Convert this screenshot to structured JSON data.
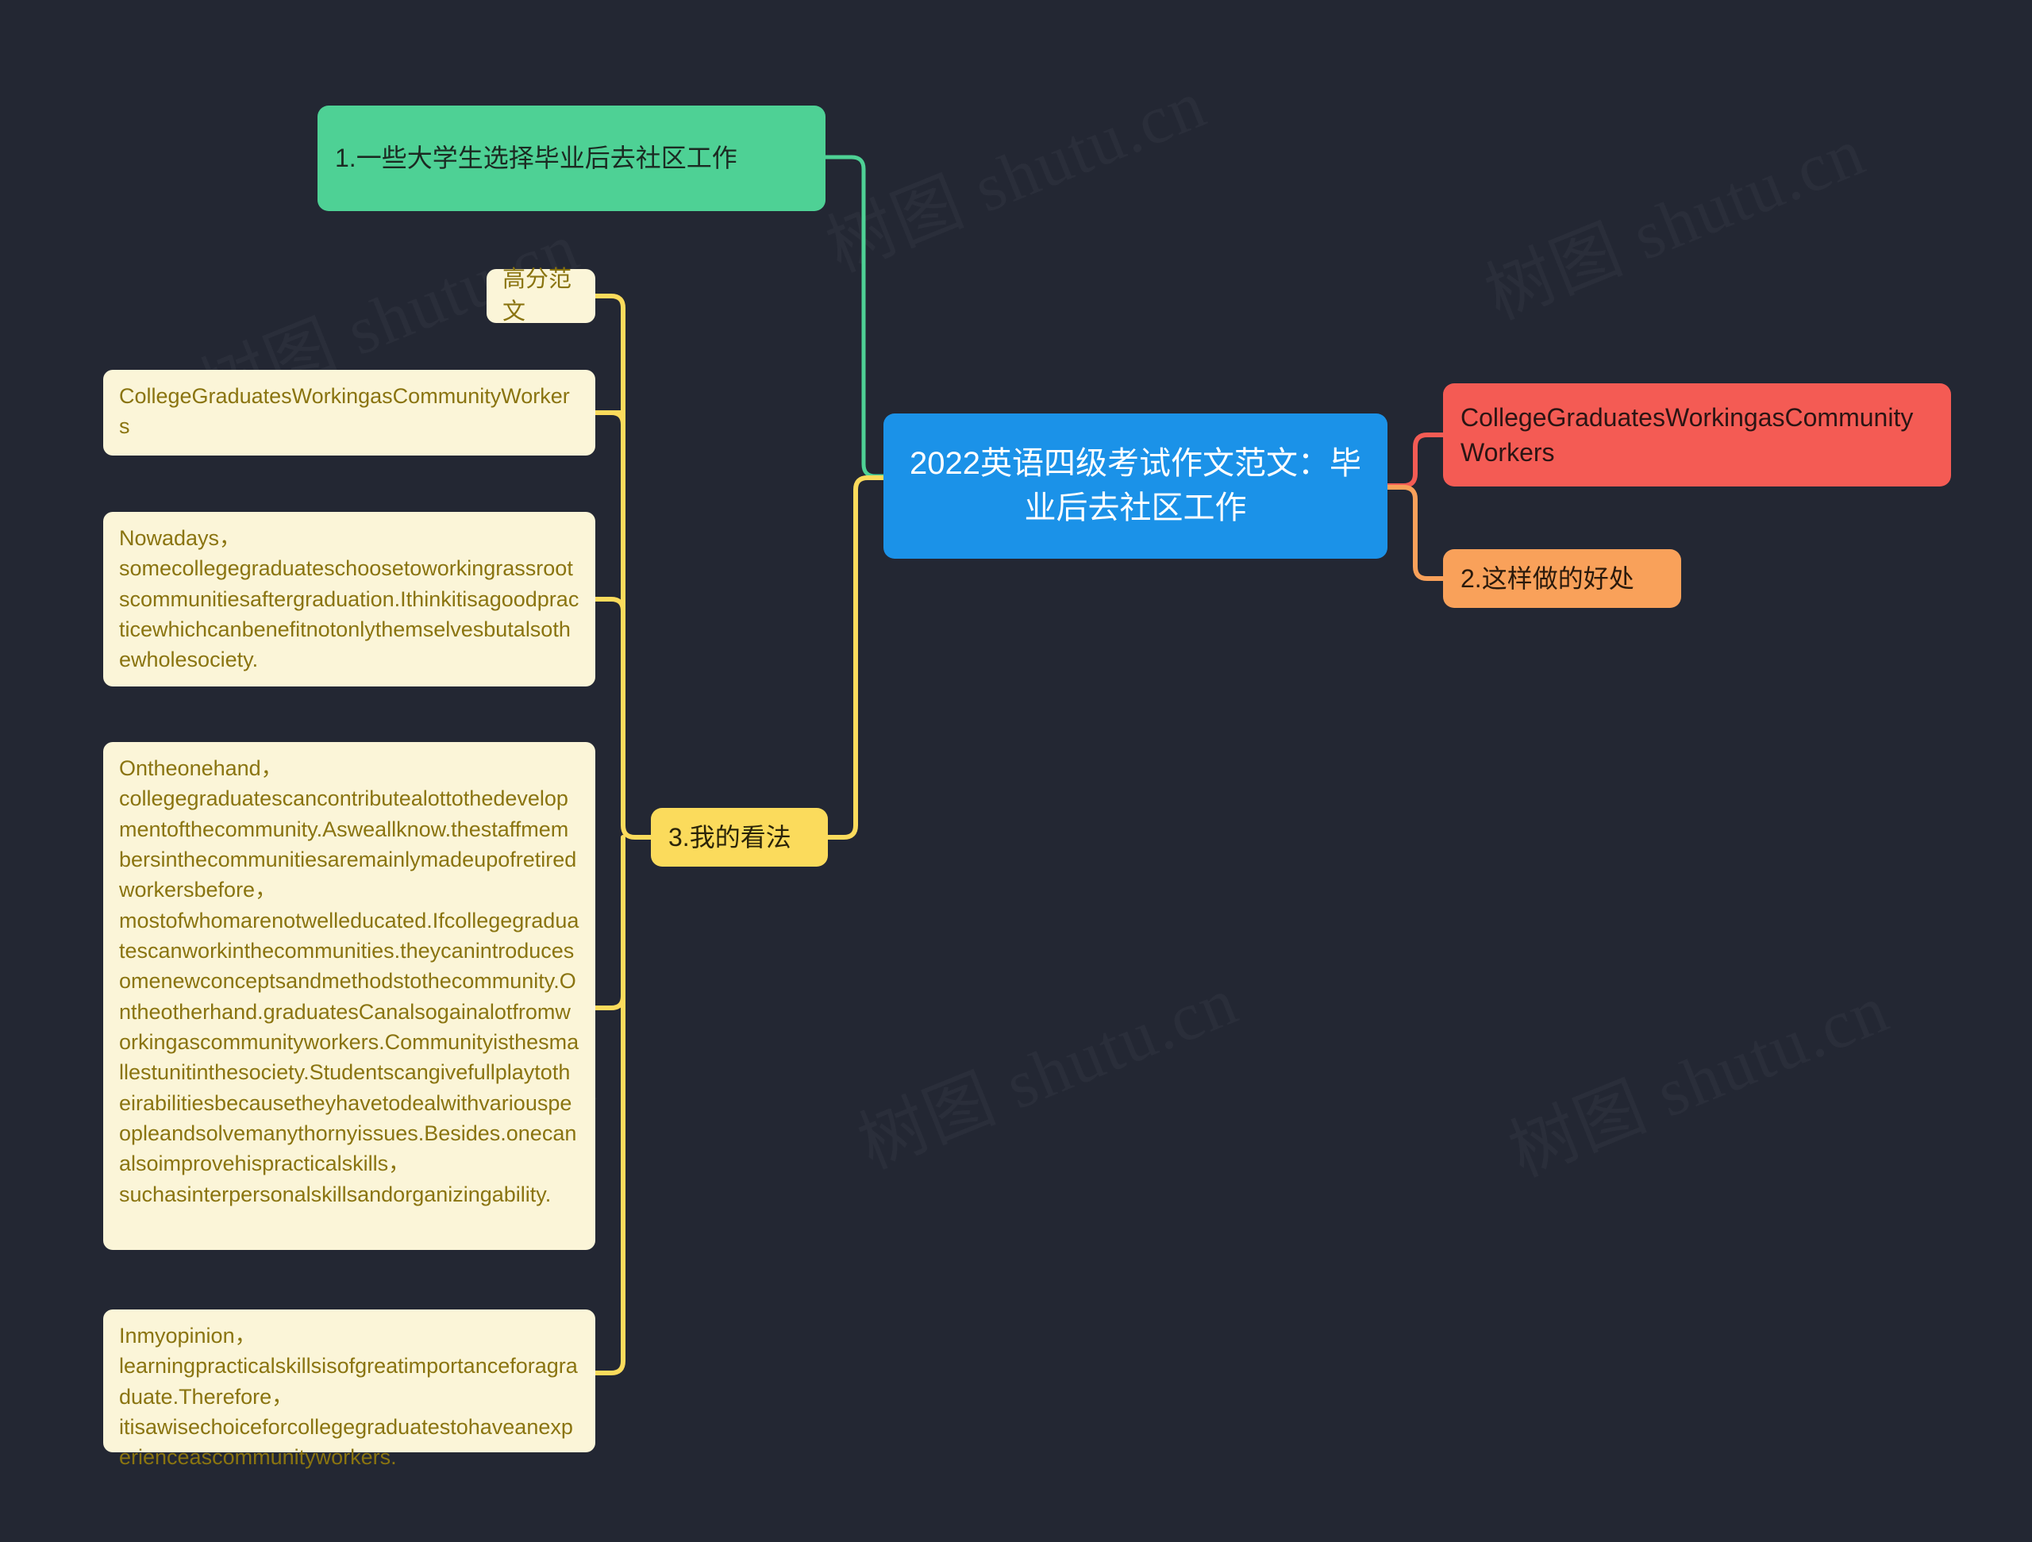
{
  "canvas": {
    "background": "#232733",
    "watermark_text": "树图 shutu.cn"
  },
  "palette": {
    "root": "#1b92e8",
    "green": "#4ed195",
    "red": "#f45b54",
    "orange": "#f9a15a",
    "yellow": "#fbdb5c",
    "cream": "#fbf5d8",
    "cream_text": "#8a7410",
    "background": "#232733"
  },
  "mindmap": {
    "root": {
      "label": "2022英语四级考试作文范文：毕业后去社区工作",
      "color": "#1b92e8"
    },
    "branches": [
      {
        "id": "branch-1",
        "label": "1.一些大学生选择毕业后去社区工作",
        "color": "#4ed195",
        "side": "left-top"
      },
      {
        "id": "branch-2",
        "label": "CollegeGraduatesWorkingasCommunityWorkers",
        "color": "#f45b54",
        "side": "right-top"
      },
      {
        "id": "branch-3",
        "label": "2.这样做的好处",
        "color": "#f9a15a",
        "side": "right-bottom"
      },
      {
        "id": "branch-4",
        "label": "3.我的看法",
        "color": "#fbdb5c",
        "side": "left-bottom",
        "children": [
          {
            "id": "leaf-1",
            "label": "高分范文"
          },
          {
            "id": "leaf-2",
            "label": "CollegeGraduatesWorkingasCommunityWorkers"
          },
          {
            "id": "leaf-3",
            "label": "Nowadays，somecollegegraduateschoosetoworkingrassrootscommunitiesaftergraduation.Ithinkitisagoodpracticewhichcanbenefitnotonlythemselvesbutalsothewholesociety."
          },
          {
            "id": "leaf-4",
            "label": "Ontheonehand，collegegraduatescancontributealottothedevelopmentofthecommunity.Asweallknow.thestaffmembersinthecommunitiesaremainlymadeupofretiredworkersbefore，mostofwhomarenotwelleducated.Ifcollegegraduatescanworkinthecommunities.theycanintroducesomenewconceptsandmethodstothecommunity.Ontheotherhand.graduatesCanalsogainalotfromworkingascommunityworkers.Communityisthesmallestunitinthesociety.Studentscangivefullplaytotheirabilitiesbecausetheyhavetodealwithvariouspeopleandsolvemanythornyissues.Besides.onecanalsoimprovehispracticalskills，suchasinterpersonalskillsandorganizingability."
          },
          {
            "id": "leaf-5",
            "label": "Inmyopinion，learningpracticalskillsisofgreatimportanceforagraduate.Therefore，itisawisechoiceforcollegegraduatestohaveanexperienceascommunityworkers."
          }
        ]
      }
    ]
  }
}
